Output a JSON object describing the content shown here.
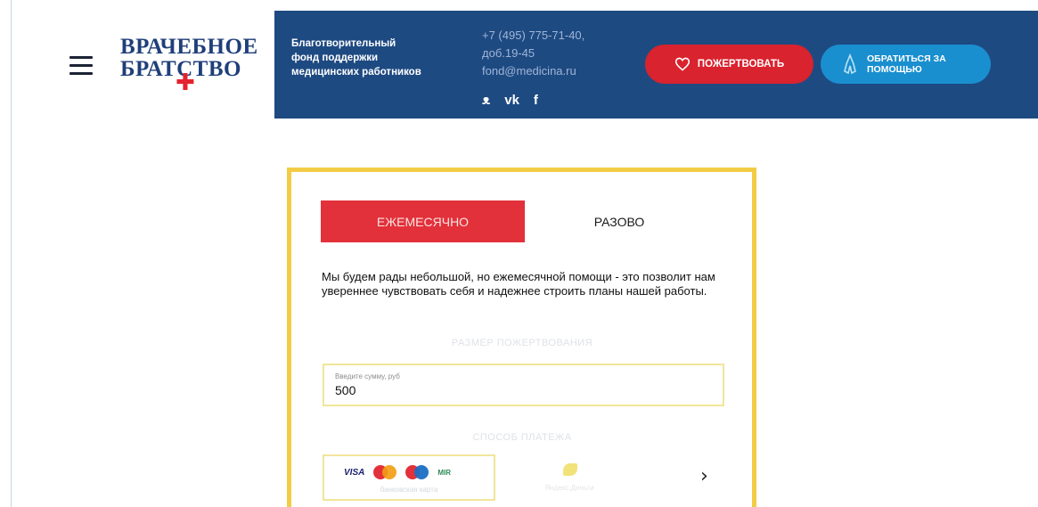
{
  "logo": {
    "line1": "ВРАЧЕБНОЕ",
    "line2": "БРАТСТВО",
    "cross": "✚"
  },
  "header": {
    "fund_lines": [
      "Благотворительный",
      "фонд поддержки",
      "медицинских работников"
    ],
    "phone": "+7 (495) 775-71-40,",
    "ext": "доб.19-45",
    "email": "fond@medicina.ru",
    "socials": [
      "ok-icon",
      "vk-icon",
      "facebook-icon"
    ],
    "social_glyphs": [
      "ᴥ",
      "vk",
      "f"
    ],
    "donate_label": "ПОЖЕРТВОВАТЬ",
    "help_label": "ОБРАТИТЬСЯ ЗА ПОМОЩЬЮ"
  },
  "tabs": {
    "monthly": "ЕЖЕМЕСЯЧНО",
    "once": "РАЗОВО",
    "active": "monthly"
  },
  "description": "Мы будем рады небольшой, но ежемесячной помощи - это позволит нам увереннее чувствовать себя и надежнее строить планы нашей работы.",
  "amount": {
    "section_label": "РАЗМЕР ПОЖЕРТВОВАНИЯ",
    "placeholder": "Введите сумму, руб",
    "value": "500"
  },
  "payment": {
    "section_label": "СПОСОБ ПЛАТЕЖА",
    "card_brands": [
      "VISA",
      "MIR"
    ],
    "card_label": "банковская карта",
    "wallet_label": "Яндекс.Деньги"
  },
  "colors": {
    "header_bg": "#1e4a82",
    "donate": "#d9232e",
    "help": "#1a8fcf",
    "card_border": "#f3cc45",
    "active_tab": "#e2313a",
    "logo": "#1f3f7a"
  }
}
